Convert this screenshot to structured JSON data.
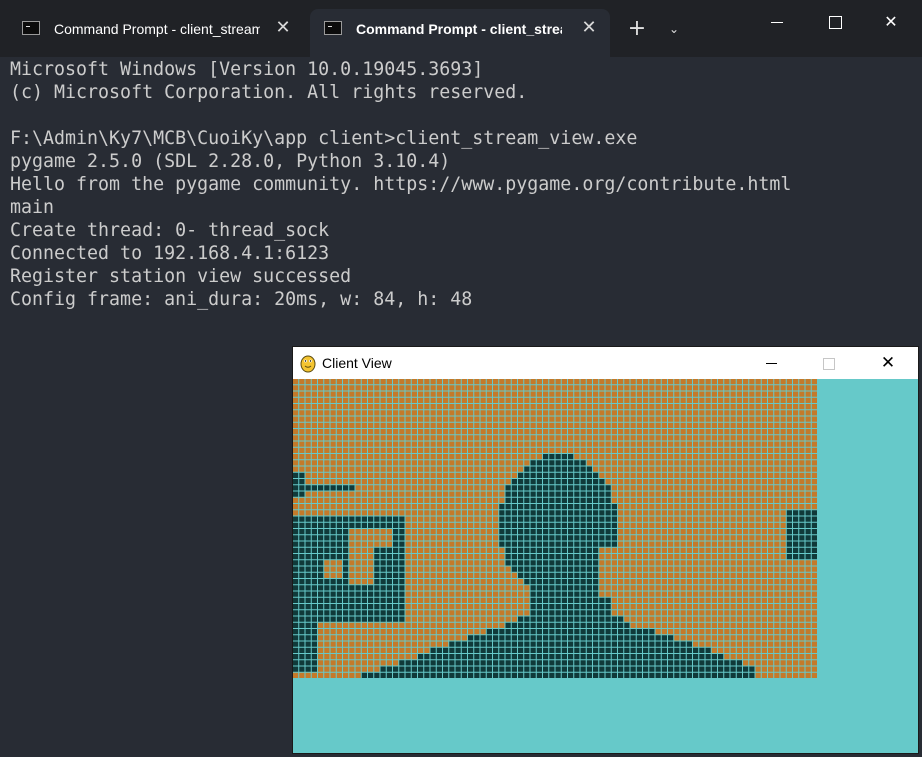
{
  "tabs": [
    {
      "title": "Command Prompt - client_stream_view.exe",
      "active": false
    },
    {
      "title": "Command Prompt - client_stream_view.exe",
      "active": true
    }
  ],
  "icons": {
    "tab": "command-prompt-icon",
    "close": "close-icon",
    "new_tab": "plus-icon",
    "dropdown": "chevron-down-icon",
    "minimize": "minimize-icon",
    "maximize": "maximize-icon",
    "pygame": "pygame-snake-icon"
  },
  "glyphs": {
    "close": "✕",
    "new_tab": "+",
    "dropdown": "⌄"
  },
  "terminal": {
    "lines": [
      "Microsoft Windows [Version 10.0.19045.3693]",
      "(c) Microsoft Corporation. All rights reserved.",
      "",
      "F:\\Admin\\Ky7\\MCB\\CuoiKy\\app client>client_stream_view.exe",
      "pygame 2.5.0 (SDL 2.28.0, Python 3.10.4)",
      "Hello from the pygame community. https://www.pygame.org/contribute.html",
      "main",
      "Create thread: 0- thread_sock",
      "Connected to 192.168.4.1:6123",
      "Register station view successed",
      "Config frame: ani_dura: 20ms, w: 84, h: 48"
    ]
  },
  "client_view": {
    "title": "Client View",
    "frame": {
      "width": 84,
      "height": 48,
      "ani_dura": "20ms"
    }
  },
  "colors": {
    "terminal_bg": "#282c34",
    "tabbar_bg": "#202226",
    "terminal_text": "#cccccc",
    "window_bg": "#66c9c9",
    "pixel_light": "#c47a2a",
    "pixel_dark": "#103a3a",
    "grid_line": "#66c9c9"
  }
}
